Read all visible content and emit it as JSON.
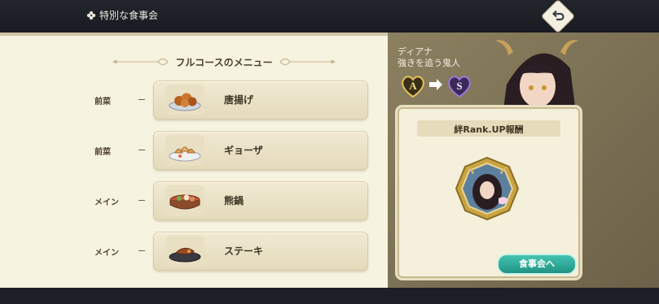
{
  "header": {
    "title": "特別な食事会",
    "title_icon": "fleur-icon",
    "back_icon": "return-arrow-icon"
  },
  "menu": {
    "heading": "フルコースのメニュー",
    "courses": [
      {
        "course": "前菜",
        "dish": "唐揚げ",
        "icon": "karaage-plate-icon"
      },
      {
        "course": "前菜",
        "dish": "ギョーザ",
        "icon": "gyoza-plate-icon"
      },
      {
        "course": "メイン",
        "dish": "熊鍋",
        "icon": "bear-hotpot-icon"
      },
      {
        "course": "メイン",
        "dish": "ステーキ",
        "icon": "steak-plate-icon"
      }
    ]
  },
  "character": {
    "name": "ディアナ",
    "title": "強きを追う鬼人",
    "rank_from": "A",
    "rank_to": "S"
  },
  "reward": {
    "title": "絆Rank.UP報酬",
    "medal_icon": "character-medal-icon",
    "button_label": "食事会へ"
  },
  "colors": {
    "panel_bg": "#f7f3e1",
    "accent_teal": "#2aa896",
    "rank_gold": "#e2c25a",
    "rank_purple": "#7a56b8"
  }
}
